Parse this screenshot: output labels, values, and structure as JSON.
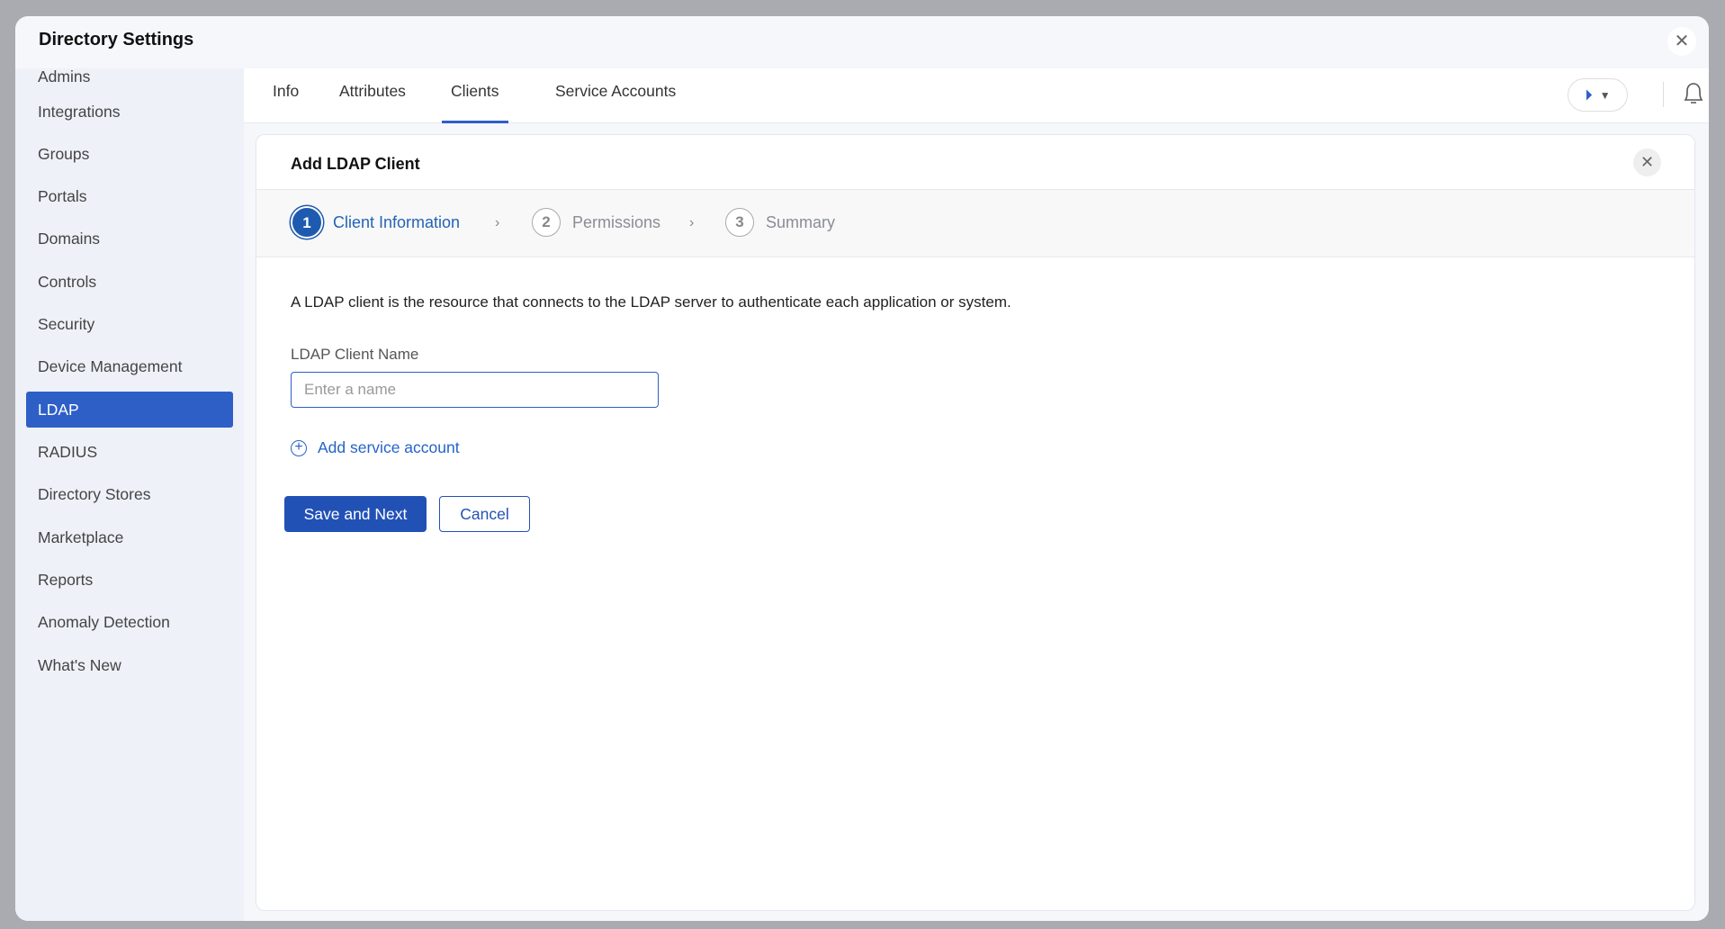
{
  "modal": {
    "title": "Directory Settings"
  },
  "sidebar": {
    "items": [
      {
        "label": "Admins"
      },
      {
        "label": "Integrations"
      },
      {
        "label": "Groups"
      },
      {
        "label": "Portals"
      },
      {
        "label": "Domains"
      },
      {
        "label": "Controls"
      },
      {
        "label": "Security"
      },
      {
        "label": "Device Management"
      },
      {
        "label": "LDAP",
        "active": true
      },
      {
        "label": "RADIUS"
      },
      {
        "label": "Directory Stores"
      },
      {
        "label": "Marketplace"
      },
      {
        "label": "Reports"
      },
      {
        "label": "Anomaly Detection"
      },
      {
        "label": "What's New"
      }
    ]
  },
  "tabs": [
    {
      "label": "Info"
    },
    {
      "label": "Attributes"
    },
    {
      "label": "Clients",
      "active": true
    },
    {
      "label": "Service Accounts"
    }
  ],
  "card": {
    "title": "Add LDAP Client",
    "steps": [
      {
        "num": "1",
        "label": "Client Information"
      },
      {
        "num": "2",
        "label": "Permissions"
      },
      {
        "num": "3",
        "label": "Summary"
      }
    ],
    "description": "A LDAP client is the resource that connects to the LDAP server to authenticate each application or system.",
    "name_label": "LDAP Client Name",
    "name_placeholder": "Enter a name",
    "name_value": "",
    "add_service_account": "Add service account",
    "save_label": "Save and Next",
    "cancel_label": "Cancel"
  },
  "colors": {
    "accent": "#2e5fc7"
  }
}
